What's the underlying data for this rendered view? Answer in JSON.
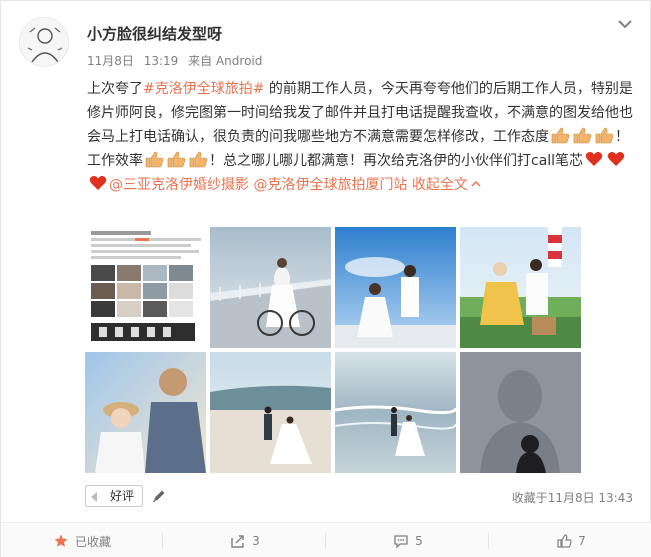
{
  "post": {
    "username": "小方脸很纠结发型呀",
    "date": "11月8日",
    "time": "13:19",
    "source": "来自 Android",
    "text": {
      "p1": "上次夸了",
      "topic1": "#克洛伊全球旅拍#",
      "p2": " 的前期工作人员，今天再夸夸他们的后期工作人员，特别是修片师阿良，修完图第一时间给我发了邮件并且打电话提醒我查收，不满意的图发给他也会马上打电话确认，很负责的问我哪些地方不满意需要怎样修改，工作态度",
      "p3": "！工作效率",
      "p4": "！总之哪儿哪儿都满意！再次给克洛伊的小伙伴们打call笔芯",
      "mention1": "@三亚克洛伊婚纱摄影",
      "mention2": "@克洛伊全球旅拍厦门站",
      "collapse": "收起全文"
    },
    "good_label": "好评",
    "fav_time": "收藏于11月8日 13:43"
  },
  "actions": {
    "favorited": "已收藏",
    "repost": "3",
    "comment": "5",
    "like": "7"
  },
  "colors": {
    "link": "#eb7350",
    "heart": "#e0301e",
    "thumb": "#f2b46b"
  },
  "icons": [
    "chevron-down-icon",
    "thumbs-up-emoji",
    "heart-emoji",
    "pencil-icon",
    "star-icon",
    "repost-icon",
    "comment-icon",
    "like-icon"
  ]
}
